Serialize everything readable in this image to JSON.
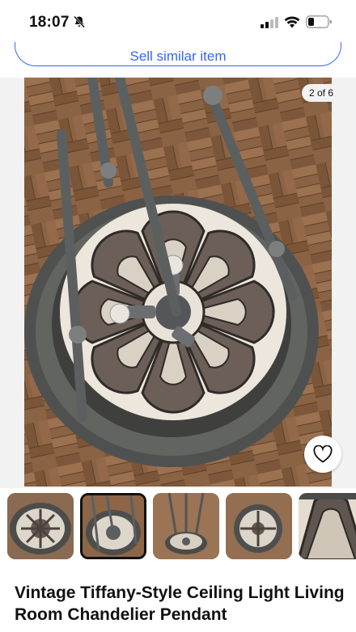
{
  "status_bar": {
    "time": "18:07",
    "icons": [
      "mute-bell-icon",
      "cellular-signal-icon",
      "wifi-icon",
      "battery-icon"
    ]
  },
  "actions": {
    "sell_similar_label": "Sell similar item"
  },
  "gallery": {
    "counter": "2 of 6",
    "main_image": "chandelier-underside-photo",
    "watch_icon": "heart-icon",
    "thumbnails": [
      {
        "image": "chandelier-shade-photo",
        "selected": false
      },
      {
        "image": "chandelier-underside-photo",
        "selected": true
      },
      {
        "image": "chandelier-hanging-photo",
        "selected": false
      },
      {
        "image": "chandelier-floor-photo",
        "selected": false
      },
      {
        "image": "stained-glass-closeup-photo",
        "selected": false
      }
    ]
  },
  "item": {
    "title": "Vintage Tiffany-Style Ceiling Light Living Room Chandelier Pendant"
  },
  "colors": {
    "accent": "#3665f3",
    "text": "#111111",
    "gallery_background": "#f2f2f2"
  }
}
